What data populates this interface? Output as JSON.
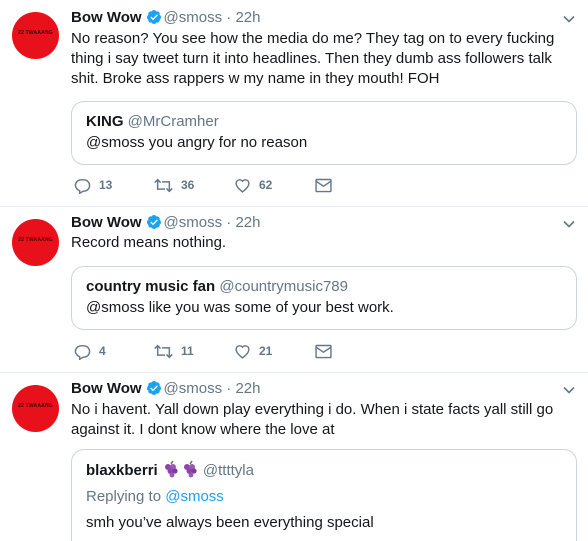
{
  "tweets": [
    {
      "name": "Bow Wow",
      "handle": "@smoss",
      "time": "22h",
      "avatar_text": "22 TWAAANG",
      "text": "No reason? You see how the media do me? They tag on to every fucking thing i say tweet turn it into headlines. Then they dumb ass followers talk shit. Broke ass rappers w my name in they mouth! FOH",
      "quote": {
        "name": "KING",
        "handle": "@MrCramher",
        "text": "@smoss you angry for no reason"
      },
      "replies": "13",
      "retweets": "36",
      "likes": "62"
    },
    {
      "name": "Bow Wow",
      "handle": "@smoss",
      "time": "22h",
      "avatar_text": "22 TWAAANG",
      "text": "Record means nothing.",
      "quote": {
        "name": "country music fan",
        "handle": "@countrymusic789",
        "text": "@smoss like you was some of your best work."
      },
      "replies": "4",
      "retweets": "11",
      "likes": "21"
    },
    {
      "name": "Bow Wow",
      "handle": "@smoss",
      "time": "22h",
      "avatar_text": "22 TWAAANG",
      "text": "No i havent. Yall down play everything i do. When i state facts yall still go against it. I dont know where the love at",
      "quote": {
        "name": "blaxkberri",
        "handle": "@ttttyla",
        "reply_prefix": "Replying to",
        "reply_handle": "@smoss",
        "text": "smh you’ve always been everything special"
      }
    }
  ],
  "dot": "·",
  "colors": {
    "avatar": "#e8101a",
    "verified": "#1da1f2",
    "muted": "#657786",
    "link": "#1da1f2"
  }
}
